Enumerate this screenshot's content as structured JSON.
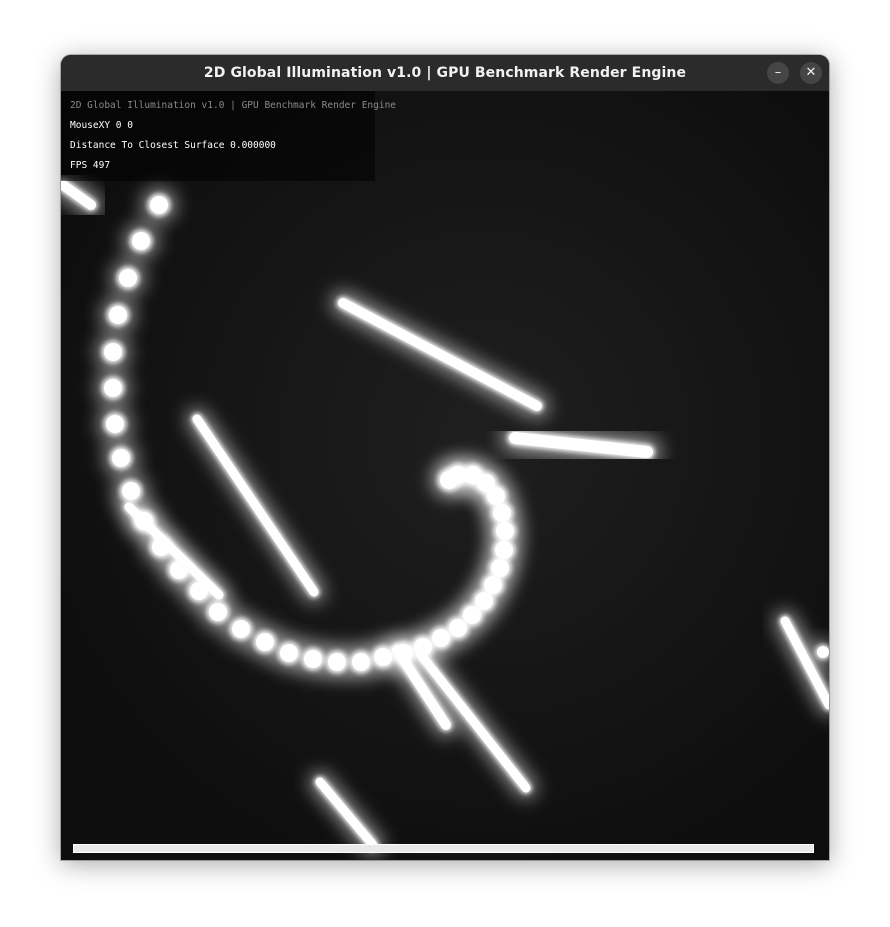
{
  "window": {
    "title": "2D Global Illumination v1.0 | GPU Benchmark Render Engine",
    "minimize_glyph": "–",
    "close_glyph": "✕"
  },
  "hud": {
    "title": "2D Global Illumination v1.0 | GPU Benchmark Render Engine",
    "mouse": "MouseXY 0 0",
    "distance": "Distance To Closest Surface 0.000000",
    "fps": "FPS 497"
  },
  "progress": {
    "fraction": 1.0
  },
  "colors": {
    "titlebar": "#2b2b2b",
    "background": "#121212",
    "light": "#ffffff"
  }
}
